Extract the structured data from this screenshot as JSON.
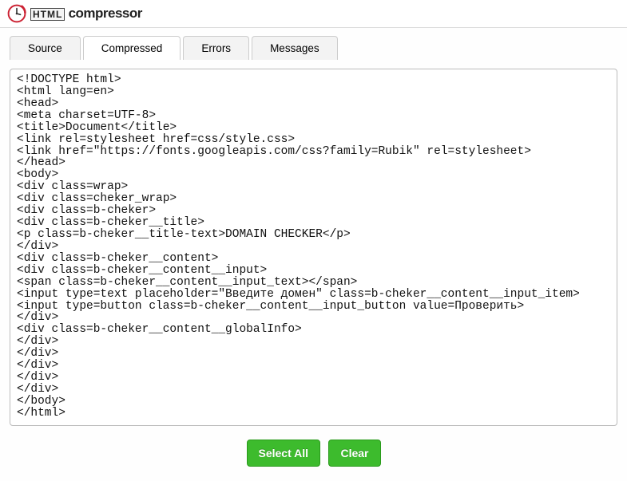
{
  "app": {
    "brand_html": "HTML",
    "brand_suffix": "compressor"
  },
  "tabs": {
    "source": "Source",
    "compressed": "Compressed",
    "errors": "Errors",
    "messages": "Messages",
    "active": "compressed"
  },
  "code": "<!DOCTYPE html>\n<html lang=en>\n<head>\n<meta charset=UTF-8>\n<title>Document</title>\n<link rel=stylesheet href=css/style.css>\n<link href=\"https://fonts.googleapis.com/css?family=Rubik\" rel=stylesheet>\n</head>\n<body>\n<div class=wrap>\n<div class=cheker_wrap>\n<div class=b-cheker>\n<div class=b-cheker__title>\n<p class=b-cheker__title-text>DOMAIN CHECKER</p>\n</div>\n<div class=b-cheker__content>\n<div class=b-cheker__content__input>\n<span class=b-cheker__content__input_text></span>\n<input type=text placeholder=\"Введите домен\" class=b-cheker__content__input_item>\n<input type=button class=b-cheker__content__input_button value=Проверить>\n</div>\n<div class=b-cheker__content__globalInfo>\n</div>\n</div>\n</div>\n</div>\n</div>\n</body>\n</html>",
  "buttons": {
    "select_all": "Select All",
    "clear": "Clear"
  }
}
